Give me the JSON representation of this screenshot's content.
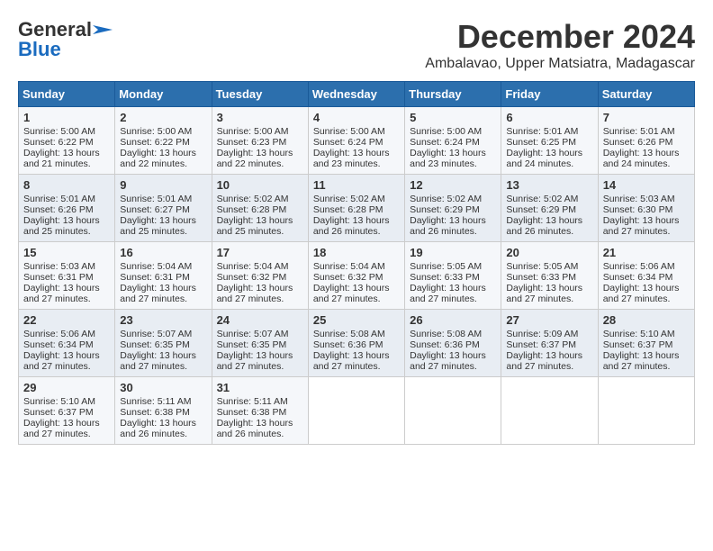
{
  "logo": {
    "line1": "General",
    "line2": "Blue"
  },
  "title": "December 2024",
  "location": "Ambalavao, Upper Matsiatra, Madagascar",
  "headers": [
    "Sunday",
    "Monday",
    "Tuesday",
    "Wednesday",
    "Thursday",
    "Friday",
    "Saturday"
  ],
  "weeks": [
    [
      {
        "day": "1",
        "sunrise": "5:00 AM",
        "sunset": "6:22 PM",
        "daylight": "13 hours and 21 minutes."
      },
      {
        "day": "2",
        "sunrise": "5:00 AM",
        "sunset": "6:22 PM",
        "daylight": "13 hours and 22 minutes."
      },
      {
        "day": "3",
        "sunrise": "5:00 AM",
        "sunset": "6:23 PM",
        "daylight": "13 hours and 22 minutes."
      },
      {
        "day": "4",
        "sunrise": "5:00 AM",
        "sunset": "6:24 PM",
        "daylight": "13 hours and 23 minutes."
      },
      {
        "day": "5",
        "sunrise": "5:00 AM",
        "sunset": "6:24 PM",
        "daylight": "13 hours and 23 minutes."
      },
      {
        "day": "6",
        "sunrise": "5:01 AM",
        "sunset": "6:25 PM",
        "daylight": "13 hours and 24 minutes."
      },
      {
        "day": "7",
        "sunrise": "5:01 AM",
        "sunset": "6:26 PM",
        "daylight": "13 hours and 24 minutes."
      }
    ],
    [
      {
        "day": "8",
        "sunrise": "5:01 AM",
        "sunset": "6:26 PM",
        "daylight": "13 hours and 25 minutes."
      },
      {
        "day": "9",
        "sunrise": "5:01 AM",
        "sunset": "6:27 PM",
        "daylight": "13 hours and 25 minutes."
      },
      {
        "day": "10",
        "sunrise": "5:02 AM",
        "sunset": "6:28 PM",
        "daylight": "13 hours and 25 minutes."
      },
      {
        "day": "11",
        "sunrise": "5:02 AM",
        "sunset": "6:28 PM",
        "daylight": "13 hours and 26 minutes."
      },
      {
        "day": "12",
        "sunrise": "5:02 AM",
        "sunset": "6:29 PM",
        "daylight": "13 hours and 26 minutes."
      },
      {
        "day": "13",
        "sunrise": "5:02 AM",
        "sunset": "6:29 PM",
        "daylight": "13 hours and 26 minutes."
      },
      {
        "day": "14",
        "sunrise": "5:03 AM",
        "sunset": "6:30 PM",
        "daylight": "13 hours and 27 minutes."
      }
    ],
    [
      {
        "day": "15",
        "sunrise": "5:03 AM",
        "sunset": "6:31 PM",
        "daylight": "13 hours and 27 minutes."
      },
      {
        "day": "16",
        "sunrise": "5:04 AM",
        "sunset": "6:31 PM",
        "daylight": "13 hours and 27 minutes."
      },
      {
        "day": "17",
        "sunrise": "5:04 AM",
        "sunset": "6:32 PM",
        "daylight": "13 hours and 27 minutes."
      },
      {
        "day": "18",
        "sunrise": "5:04 AM",
        "sunset": "6:32 PM",
        "daylight": "13 hours and 27 minutes."
      },
      {
        "day": "19",
        "sunrise": "5:05 AM",
        "sunset": "6:33 PM",
        "daylight": "13 hours and 27 minutes."
      },
      {
        "day": "20",
        "sunrise": "5:05 AM",
        "sunset": "6:33 PM",
        "daylight": "13 hours and 27 minutes."
      },
      {
        "day": "21",
        "sunrise": "5:06 AM",
        "sunset": "6:34 PM",
        "daylight": "13 hours and 27 minutes."
      }
    ],
    [
      {
        "day": "22",
        "sunrise": "5:06 AM",
        "sunset": "6:34 PM",
        "daylight": "13 hours and 27 minutes."
      },
      {
        "day": "23",
        "sunrise": "5:07 AM",
        "sunset": "6:35 PM",
        "daylight": "13 hours and 27 minutes."
      },
      {
        "day": "24",
        "sunrise": "5:07 AM",
        "sunset": "6:35 PM",
        "daylight": "13 hours and 27 minutes."
      },
      {
        "day": "25",
        "sunrise": "5:08 AM",
        "sunset": "6:36 PM",
        "daylight": "13 hours and 27 minutes."
      },
      {
        "day": "26",
        "sunrise": "5:08 AM",
        "sunset": "6:36 PM",
        "daylight": "13 hours and 27 minutes."
      },
      {
        "day": "27",
        "sunrise": "5:09 AM",
        "sunset": "6:37 PM",
        "daylight": "13 hours and 27 minutes."
      },
      {
        "day": "28",
        "sunrise": "5:10 AM",
        "sunset": "6:37 PM",
        "daylight": "13 hours and 27 minutes."
      }
    ],
    [
      {
        "day": "29",
        "sunrise": "5:10 AM",
        "sunset": "6:37 PM",
        "daylight": "13 hours and 27 minutes."
      },
      {
        "day": "30",
        "sunrise": "5:11 AM",
        "sunset": "6:38 PM",
        "daylight": "13 hours and 26 minutes."
      },
      {
        "day": "31",
        "sunrise": "5:11 AM",
        "sunset": "6:38 PM",
        "daylight": "13 hours and 26 minutes."
      },
      null,
      null,
      null,
      null
    ]
  ],
  "labels": {
    "sunrise": "Sunrise:",
    "sunset": "Sunset:",
    "daylight": "Daylight:"
  }
}
